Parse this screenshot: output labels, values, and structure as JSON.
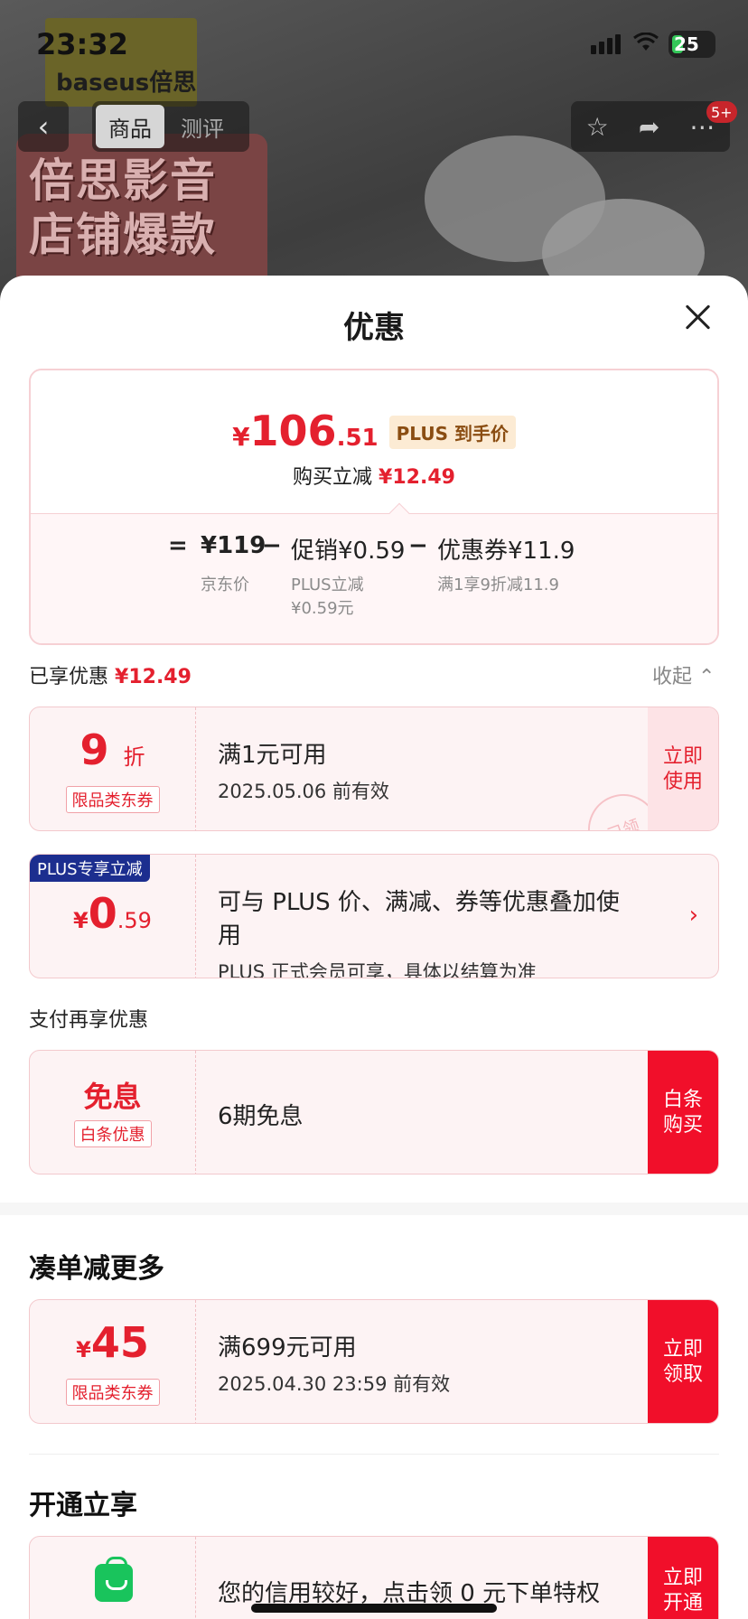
{
  "status": {
    "time": "23:32",
    "battery": "25"
  },
  "background": {
    "brand": "baseus倍思",
    "promo_line1": "倍思影音",
    "promo_line2": "店铺爆款"
  },
  "nav": {
    "tabs": [
      "商品",
      "测评"
    ],
    "badge": "5+"
  },
  "sheet": {
    "title": "优惠",
    "summary": {
      "currency": "¥",
      "price_int": "106",
      "price_dec": ".51",
      "plus_tag": "PLUS 到手价",
      "save_label": "购买立减",
      "save_amount": "¥12.49",
      "eq": "=",
      "jd_price": "¥119",
      "jd_label": "京东价",
      "minus1": "−",
      "promo": "促销¥0.59",
      "promo_sub1": "PLUS立减",
      "promo_sub2": "¥0.59元",
      "minus2": "−",
      "coupon": "优惠券¥11.9",
      "coupon_sub": "满1享9折减11.9"
    },
    "enjoyed": {
      "label": "已享优惠",
      "amount": "¥12.49",
      "collapse": "收起"
    },
    "coupons": [
      {
        "big": "9",
        "unit": "折",
        "tag": "限品类东券",
        "line1": "满1元可用",
        "line2": "2025.05.06 前有效",
        "action": "立即使用",
        "stamp": "已领"
      },
      {
        "ribbon": "PLUS专享立减",
        "currency": "¥",
        "big": "0",
        "dec": ".59",
        "line1": "可与 PLUS 价、满减、券等优惠叠加使用",
        "line2": "PLUS 正式会员可享，具体以结算为准"
      }
    ],
    "pay": {
      "label": "支付再享优惠",
      "big": "免息",
      "tag": "白条优惠",
      "line1": "6期免息",
      "action": "白条购买"
    },
    "more": {
      "title": "凑单减更多",
      "currency": "¥",
      "big": "45",
      "tag": "限品类东券",
      "line1": "满699元可用",
      "line2": "2025.04.30 23:59 前有效",
      "action": "立即领取"
    },
    "open": {
      "title": "开通立享",
      "line1": "您的信用较好，点击领 0 元下单特权",
      "action": "立即开通"
    }
  }
}
